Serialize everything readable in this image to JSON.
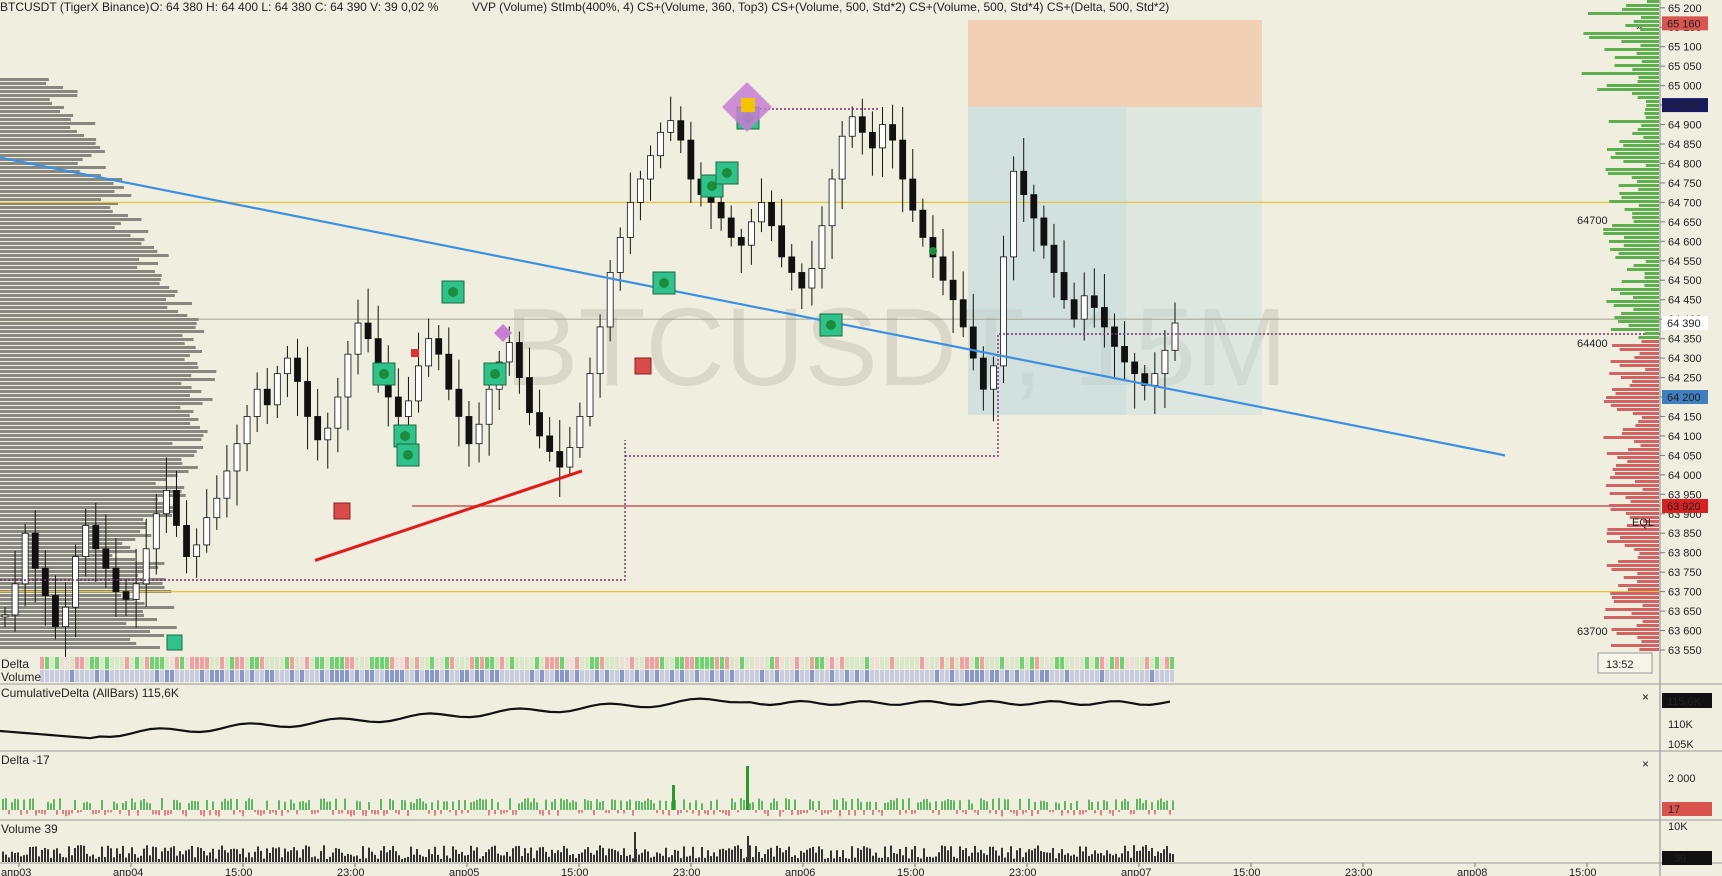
{
  "header": {
    "symbol": "BTCUSDT (TigerX Binance)",
    "ohlc": "O: 64 380   H: 64 400   L: 64 380   C: 64 390   V: 39   0,02 %",
    "indicators": "VVP (Volume)   StImb(400%, 4)   CS+(Volume, 360, Top3)   CS+(Volume, 500, Std*2)   CS+(Volume, 500, Std*4)   CS+(Delta, 500, Std*2)"
  },
  "watermark": "BTCUSDT, 15M",
  "colors": {
    "background": "#efeedf",
    "candle": "#111111",
    "trendline_blue": "#3f8fe0",
    "trendline_red": "#e01b1b",
    "level_yellow": "#e8c43a",
    "level_red": "#c83a3a",
    "volume_profile": "#888880",
    "profile_up": "#5fae4f",
    "profile_down": "#d06464",
    "imbalance_green": "#2fc28a",
    "imbalance_red": "#d94a4a",
    "cluster_purple": "#c77ed3"
  },
  "price_axis": {
    "ticks": [
      "65 200",
      "65 150",
      "65 100",
      "65 050",
      "65 000",
      "64 950",
      "64 900",
      "64 850",
      "64 800",
      "64 750",
      "64 700",
      "64 650",
      "64 600",
      "64 550",
      "64 500",
      "64 450",
      "64 400",
      "64 350",
      "64 300",
      "64 250",
      "64 200",
      "64 150",
      "64 100",
      "64 050",
      "64 000",
      "63 950",
      "63 900",
      "63 850",
      "63 800",
      "63 750",
      "63 700",
      "63 650",
      "63 600",
      "63 550"
    ],
    "badges": [
      {
        "label": "65 160",
        "price": 65160,
        "color": "#d9534f",
        "text_color": "#ffffff"
      },
      {
        "label": "64 950",
        "price": 64950,
        "color": "#1a1a5e",
        "text_color": "#ffffff"
      },
      {
        "label": "64 390",
        "price": 64390,
        "color": "#ffffff",
        "text_color": "#111111"
      },
      {
        "label": "64 200",
        "price": 64200,
        "color": "#3f7fbf",
        "text_color": "#ffffff"
      },
      {
        "label": "63 920",
        "price": 63920,
        "color": "#d92020",
        "text_color": "#ffffff"
      }
    ],
    "eql_label": "EQL",
    "timer": "13:52"
  },
  "levels": {
    "upper_label": "64700",
    "upper_price": 64700,
    "mid_label": "64400",
    "mid_price": 64400,
    "lower_label": "63700",
    "lower_price": 63700,
    "eql_price": 63920
  },
  "time_axis": {
    "labels": [
      "апр03",
      "апр04",
      "15:00",
      "23:00",
      "апр05",
      "15:00",
      "23:00",
      "апр06",
      "15:00",
      "23:00",
      "апр07",
      "15:00",
      "23:00",
      "апр08",
      "15:00"
    ]
  },
  "strip_labels": {
    "delta": "Delta",
    "volume": "Volume"
  },
  "panes": {
    "cumdelta": {
      "title": "CumulativeDelta (AllBars)  115,6K",
      "axis": [
        "110K",
        "105K"
      ],
      "badge": "115,6K"
    },
    "delta": {
      "title": "Delta -17",
      "axis": [
        "2 000"
      ],
      "badge": "17"
    },
    "volume": {
      "title": "Volume  39",
      "axis": [
        "10K"
      ],
      "badge": "39"
    }
  },
  "chart_data": {
    "type": "candlestick",
    "symbol": "BTCUSDT",
    "timeframe": "15M",
    "price_range": [
      63550,
      65220
    ],
    "last_price": 64390,
    "trendlines": [
      {
        "name": "descending",
        "color": "#3f8fe0",
        "points": [
          [
            0,
            64815
          ],
          [
            1505,
            64050
          ]
        ]
      },
      {
        "name": "ascending",
        "color": "#e01b1b",
        "points": [
          [
            315,
            63780
          ],
          [
            582,
            64010
          ]
        ]
      }
    ],
    "closes": [
      63640,
      63720,
      63850,
      63760,
      63690,
      63610,
      63660,
      63790,
      63870,
      63810,
      63760,
      63700,
      63680,
      63720,
      63810,
      63900,
      63960,
      63870,
      63790,
      63820,
      63890,
      63940,
      64010,
      64080,
      64150,
      64220,
      64180,
      64260,
      64300,
      64240,
      64150,
      64090,
      64120,
      64200,
      64310,
      64390,
      64350,
      64280,
      64200,
      64150,
      64190,
      64280,
      64350,
      64310,
      64220,
      64150,
      64080,
      64130,
      64220,
      64290,
      64340,
      64250,
      64160,
      64100,
      64060,
      64020,
      64070,
      64150,
      64260,
      64380,
      64520,
      64610,
      64700,
      64760,
      64820,
      64880,
      64910,
      64860,
      64760,
      64720,
      64700,
      64660,
      64610,
      64590,
      64650,
      64700,
      64640,
      64560,
      64520,
      64480,
      64530,
      64640,
      64760,
      64870,
      64920,
      64880,
      64840,
      64900,
      64860,
      64760,
      64680,
      64610,
      64560,
      64500,
      64450,
      64380,
      64300,
      64220,
      64280,
      64560,
      64780,
      64720,
      64660,
      64590,
      64520,
      64450,
      64400,
      64460,
      64430,
      64380,
      64330,
      64290,
      64260,
      64230,
      64260,
      64320,
      64390
    ]
  }
}
